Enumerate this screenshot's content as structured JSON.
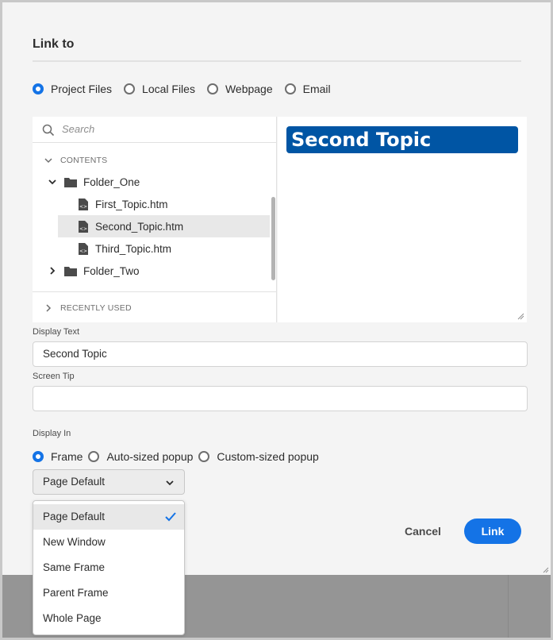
{
  "dialog": {
    "title": "Link to",
    "link_type_options": [
      {
        "label": "Project Files",
        "selected": true
      },
      {
        "label": "Local Files",
        "selected": false
      },
      {
        "label": "Webpage",
        "selected": false
      },
      {
        "label": "Email",
        "selected": false
      }
    ],
    "search": {
      "placeholder": "Search",
      "icon": "search-icon"
    },
    "tree": {
      "contents_label": "CONTENTS",
      "folder_one": "Folder_One",
      "files": [
        "First_Topic.htm",
        "Second_Topic.htm",
        "Third_Topic.htm"
      ],
      "selected_file": "Second_Topic.htm",
      "folder_two": "Folder_Two",
      "recently_used_label": "RECENTLY USED"
    },
    "preview": {
      "heading": "Second Topic"
    },
    "display_text": {
      "label": "Display Text",
      "value": "Second Topic"
    },
    "screen_tip": {
      "label": "Screen Tip",
      "value": ""
    },
    "display_in": {
      "label": "Display In",
      "options": [
        {
          "label": "Frame",
          "selected": true
        },
        {
          "label": "Auto-sized popup",
          "selected": false
        },
        {
          "label": "Custom-sized popup",
          "selected": false
        }
      ],
      "select_value": "Page Default",
      "menu_items": [
        "Page Default",
        "New Window",
        "Same Frame",
        "Parent Frame",
        "Whole Page"
      ],
      "menu_selected": "Page Default"
    },
    "buttons": {
      "cancel": "Cancel",
      "link": "Link"
    }
  },
  "colors": {
    "accent": "#1473e6",
    "preview_heading_bg": "#0055a4",
    "dialog_bg": "#f4f4f4"
  }
}
